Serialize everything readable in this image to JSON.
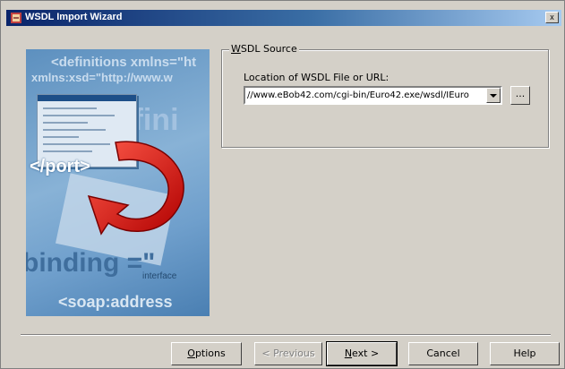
{
  "window": {
    "title": "WSDL Import Wizard",
    "close_label": "x"
  },
  "banner": {
    "line1": "<definitions xmlns=\"ht",
    "line2": "xmlns:xsd=\"http://www.w",
    "big": "<defini",
    "port": "</port>",
    "binding": "binding =\"",
    "interface": "interface",
    "soap": "<soap:address"
  },
  "source_group": {
    "label_u": "W",
    "label_rest": "SDL Source",
    "location_label": "Location of WSDL File or URL:",
    "location_value": "//www.eBob42.com/cgi-bin/Euro42.exe/wsdl/IEuro",
    "browse_label": "..."
  },
  "buttons": {
    "options_u": "O",
    "options_rest": "ptions",
    "previous_label": "< Previous",
    "next_u": "N",
    "next_rest": "ext >",
    "cancel_label": "Cancel",
    "help_label": "Help"
  }
}
